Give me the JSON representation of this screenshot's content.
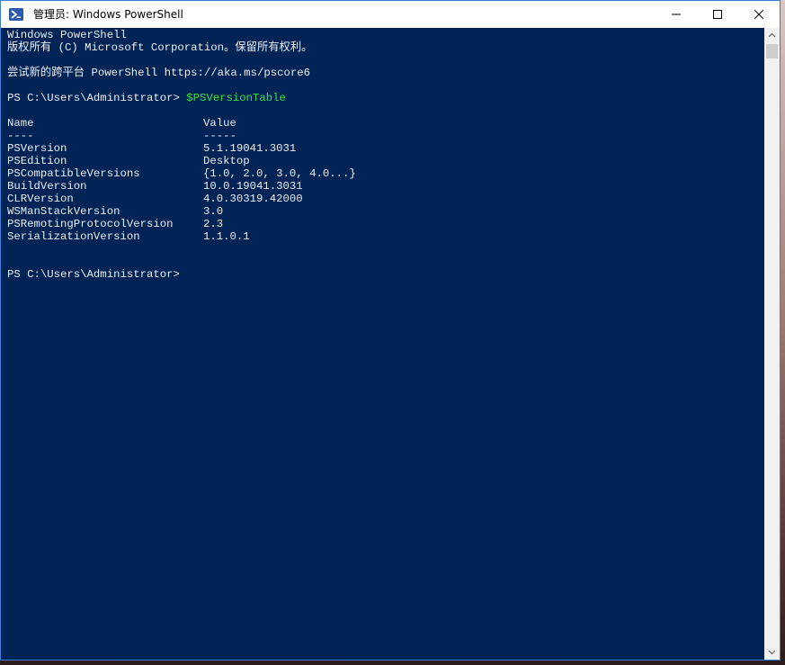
{
  "window": {
    "title": "管理员: Windows PowerShell",
    "icon": "powershell-icon",
    "controls": [
      "minimize-icon",
      "maximize-icon",
      "close-icon"
    ],
    "background_color": "#012456",
    "accent_border": "#3b7dd8"
  },
  "console": {
    "text_color": "#eeedf0",
    "command_color": "#3ce03c",
    "header_lines": [
      "Windows PowerShell",
      "版权所有 (C) Microsoft Corporation。保留所有权利。",
      "尝试新的跨平台 PowerShell https://aka.ms/pscore6"
    ],
    "prompt1": "PS C:\\Users\\Administrator> ",
    "command1": "$PSVersionTable",
    "table": {
      "headers": [
        "Name",
        "Value"
      ],
      "underlines": [
        "----",
        "-----"
      ],
      "rows": [
        [
          "PSVersion",
          "5.1.19041.3031"
        ],
        [
          "PSEdition",
          "Desktop"
        ],
        [
          "PSCompatibleVersions",
          "{1.0, 2.0, 3.0, 4.0...}"
        ],
        [
          "BuildVersion",
          "10.0.19041.3031"
        ],
        [
          "CLRVersion",
          "4.0.30319.42000"
        ],
        [
          "WSManStackVersion",
          "3.0"
        ],
        [
          "PSRemotingProtocolVersion",
          "2.3"
        ],
        [
          "SerializationVersion",
          "1.1.0.1"
        ]
      ]
    },
    "prompt2": "PS C:\\Users\\Administrator>"
  }
}
